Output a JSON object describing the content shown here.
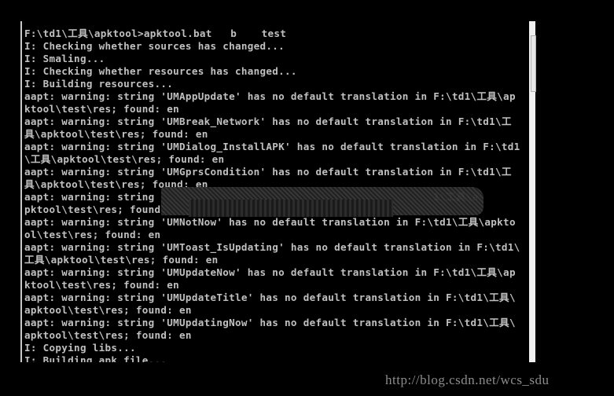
{
  "console": {
    "lines": [
      "F:\\td1\\工具\\apktool>apktool.bat   b    test",
      "I: Checking whether sources has changed...",
      "I: Smaling...",
      "I: Checking whether resources has changed...",
      "I: Building resources...",
      "aapt: warning: string 'UMAppUpdate' has no default translation in F:\\td1\\工具\\ap",
      "ktool\\test\\res; found: en",
      "aapt: warning: string 'UMBreak_Network' has no default translation in F:\\td1\\工",
      "具\\apktool\\test\\res; found: en",
      "aapt: warning: string 'UMDialog_InstallAPK' has no default translation in F:\\td1",
      "\\工具\\apktool\\test\\res; found: en",
      "aapt: warning: string 'UMGprsCondition' has no default translation in F:\\td1\\工",
      "具\\apktool\\test\\res; found: en",
      "aapt: warning: string                                             1\\工具\\a",
      "pktool\\test\\res; found.",
      "aapt: warning: string 'UMNotNow' has no default translation in F:\\td1\\工具\\apkto",
      "ol\\test\\res; found: en",
      "aapt: warning: string 'UMToast_IsUpdating' has no default translation in F:\\td1\\",
      "工具\\apktool\\test\\res; found: en",
      "aapt: warning: string 'UMUpdateNow' has no default translation in F:\\td1\\工具\\ap",
      "ktool\\test\\res; found: en",
      "aapt: warning: string 'UMUpdateTitle' has no default translation in F:\\td1\\工具\\",
      "apktool\\test\\res; found: en",
      "aapt: warning: string 'UMUpdatingNow' has no default translation in F:\\td1\\工具\\",
      "apktool\\test\\res; found: en",
      "I: Copying libs...",
      "I: Building apk file..."
    ]
  },
  "watermark": "http://blog.csdn.net/wcs_sdu",
  "colors": {
    "background": "#000000",
    "text": "#c0c0c0",
    "watermark": "#8c8c8c"
  }
}
